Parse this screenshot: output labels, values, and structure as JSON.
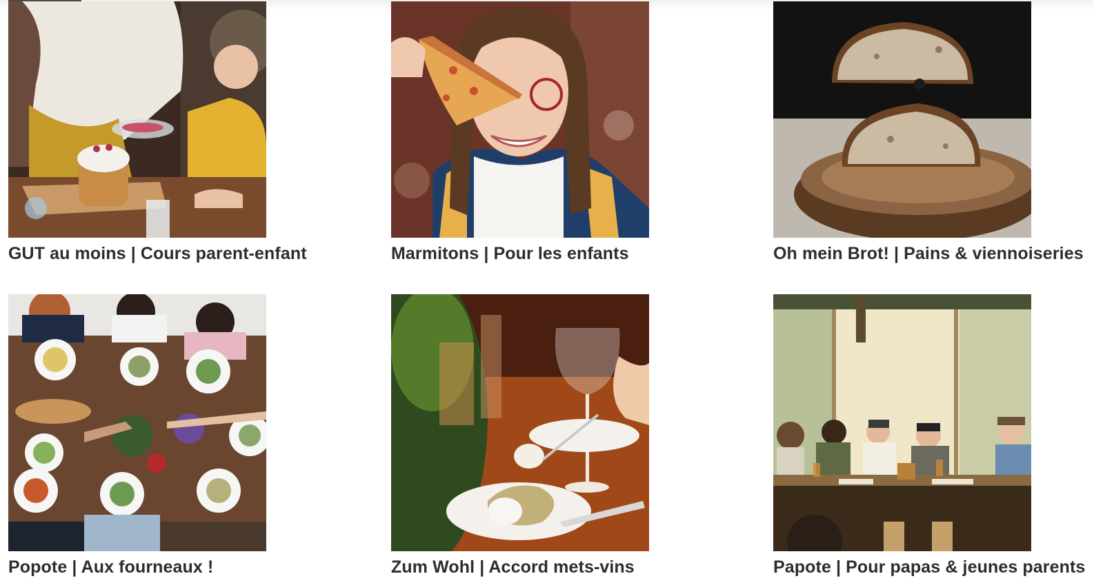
{
  "courses": [
    {
      "title": "GUT au moins | Cours parent-enfant",
      "image": "parent-child-cake-decorating-photo"
    },
    {
      "title": "Marmitons | Pour les enfants",
      "image": "girl-with-pizza-slice-photo"
    },
    {
      "title": "Oh mein Brot! | Pains & viennoiseries",
      "image": "bread-loaf-halves-on-wood-photo"
    },
    {
      "title": "Popote | Aux fourneaux !",
      "image": "friends-toasting-at-table-photo"
    },
    {
      "title": "Zum Wohl | Accord mets-vins",
      "image": "wine-glass-and-plate-photo"
    },
    {
      "title": "Papote | Pour papas & jeunes parents",
      "image": "group-at-cafe-table-photo"
    }
  ]
}
